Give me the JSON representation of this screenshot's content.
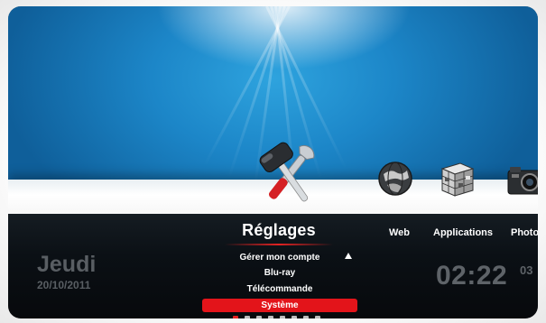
{
  "category": {
    "title": "Réglages",
    "others": [
      "Web",
      "Applications",
      "Photos"
    ]
  },
  "icons": {
    "selected": "tools-icon",
    "web": "globe-icon",
    "applications": "cube-icon",
    "photos": "camera-icon"
  },
  "submenu": {
    "items": [
      "Gérer mon compte",
      "Blu-ray",
      "Télécommande",
      "Système"
    ],
    "selected_index": 3
  },
  "date": {
    "day": "Jeudi",
    "full": "20/10/2011"
  },
  "clock": {
    "time": "02:22",
    "seconds": "03"
  },
  "colors": {
    "accent": "#e3141a",
    "panel": "#0b1015",
    "wallpaper": "#1c86c8"
  },
  "pagination": {
    "count": 8,
    "active": 0
  }
}
